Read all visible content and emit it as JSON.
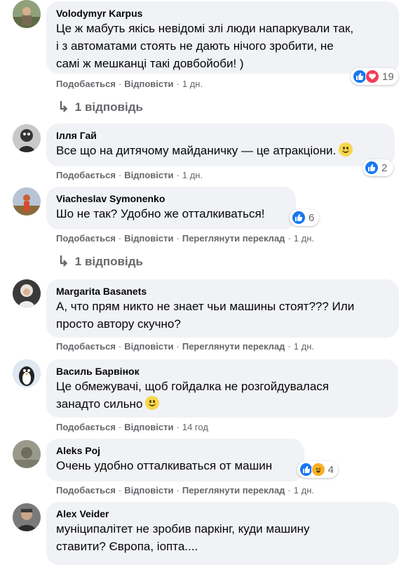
{
  "colors": {
    "bubble": "#f0f2f5",
    "meta": "#65676b",
    "like": "#1877f2",
    "love": "#f33e58",
    "haha": "#f7b125"
  },
  "labels": {
    "like": "Подобається",
    "reply": "Відповісти",
    "translate": "Переглянути переклад"
  },
  "comments": [
    {
      "author": "Volodymyr Karpus",
      "text": "Це ж мабуть якісь невідомі злі люди напаркували так,\nі з автоматами стоять не дають нічого зробити, не\nсамі ж мешканці такі довбойоби! )",
      "time": "1 дн.",
      "reactions": [
        "like-icon",
        "love-icon"
      ],
      "reaction_count": "19",
      "replies": "1 відповідь"
    },
    {
      "author": "Ілля Гай",
      "text": "Все що на дитячому майданичку — це атракціони.",
      "time": "1 дн.",
      "reactions": [
        "like-icon"
      ],
      "reaction_count": "2",
      "emoji": "slightly-smiling-face"
    },
    {
      "author": "Viacheslav Symonenko",
      "text": "Шо не так? Удобно же отталкиваться!",
      "time": "1 дн.",
      "reactions": [
        "like-icon"
      ],
      "reaction_count": "6",
      "translate": true,
      "replies": "1 відповідь"
    },
    {
      "author": "Margarita Basanets",
      "text": "А, что прям никто не знает чьи машины стоят??? Или\nпросто автору скучно?",
      "time": "1 дн.",
      "translate": true
    },
    {
      "author": "Василь Барвінок",
      "text": "Це обмежувачі, щоб гойдалка не розгойдувалася\nзанадто сильно",
      "time": "14 год",
      "emoji": "slightly-smiling-face"
    },
    {
      "author": "Aleks Poj",
      "text": "Очень удобно отталкиваться от машин",
      "time": "1 дн.",
      "reactions": [
        "like-icon",
        "haha-icon"
      ],
      "reaction_count": "4",
      "translate": true
    },
    {
      "author": "Alex Veider",
      "text": "муніципалітет не зробив паркінг, куди машину\nставити? Європа, іопта...."
    }
  ]
}
